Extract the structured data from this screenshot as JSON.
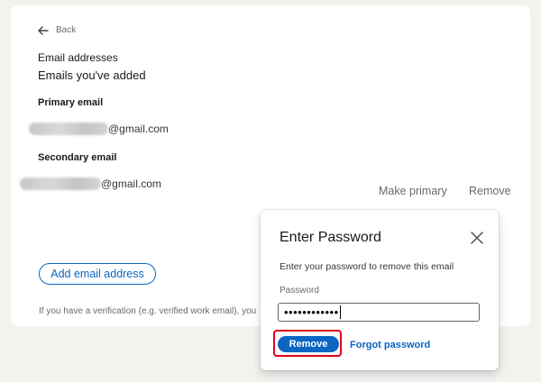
{
  "back": {
    "label": "Back",
    "icon": "arrow-left-icon"
  },
  "section": {
    "title": "Email addresses",
    "subtitle": "Emails you've added"
  },
  "primary": {
    "label": "Primary email",
    "email_suffix": "@gmail.com"
  },
  "secondary": {
    "label": "Secondary email",
    "email_suffix": "@gmail.com",
    "make_primary": "Make primary",
    "remove": "Remove"
  },
  "add_email": {
    "label": "Add email address"
  },
  "note": "If you have a verification (e.g. verified work email), you",
  "modal": {
    "title": "Enter Password",
    "description": "Enter your password to remove this email",
    "password_label": "Password",
    "password_value": "••••••••••••",
    "remove_button": "Remove",
    "forgot_link": "Forgot password"
  },
  "colors": {
    "accent": "#0a66c2",
    "highlight": "#e0001b",
    "background": "#f3f2ef"
  }
}
